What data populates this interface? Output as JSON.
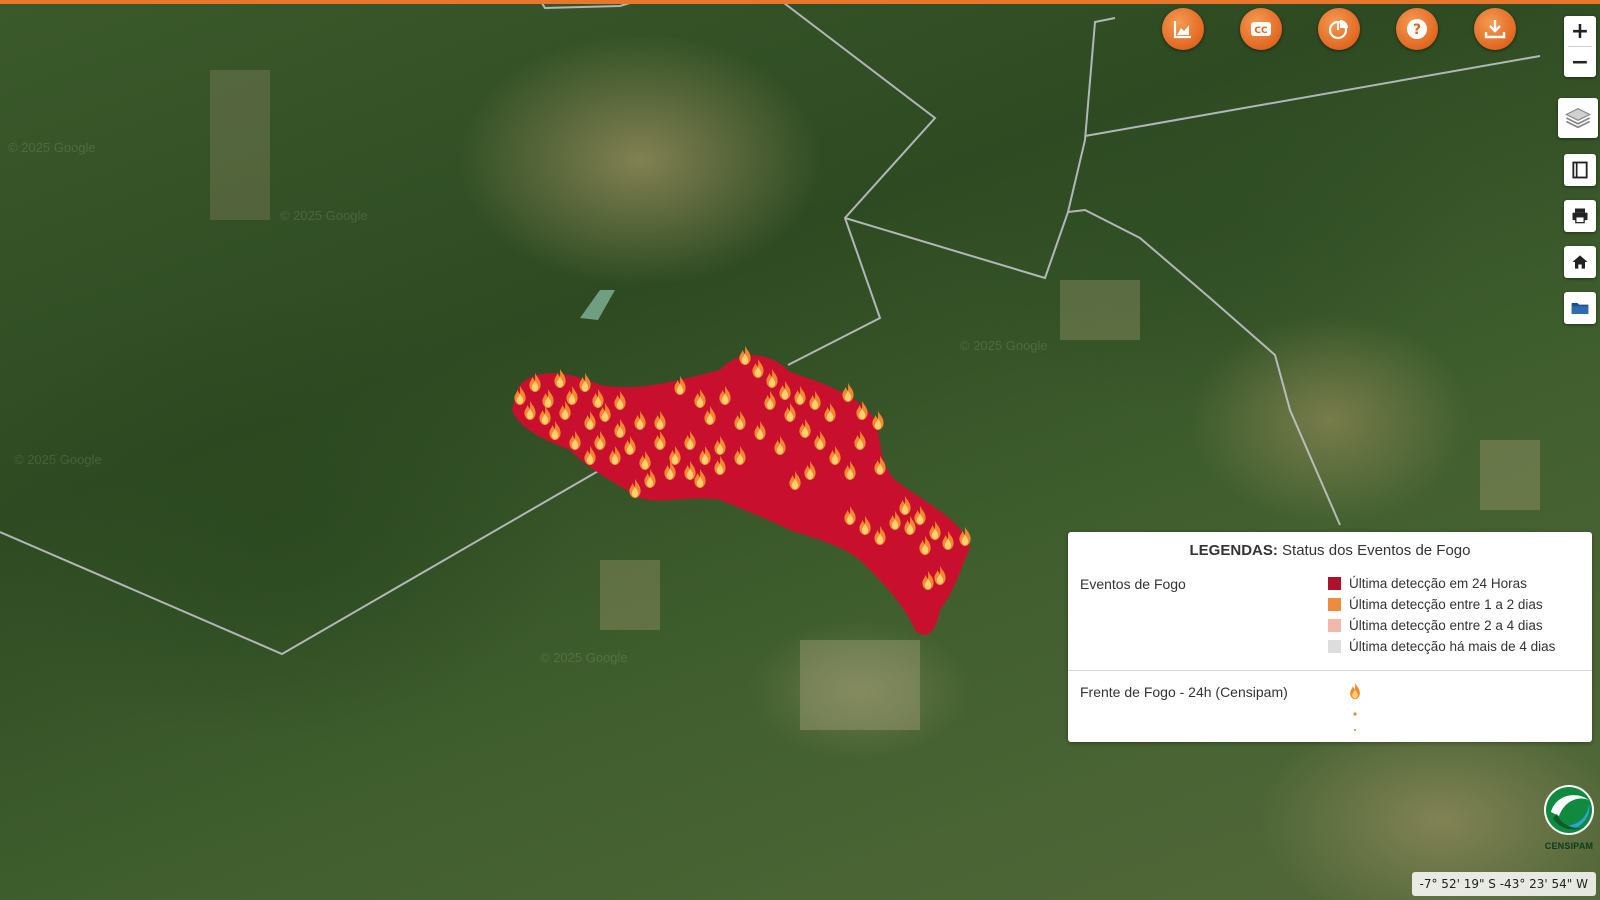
{
  "toolbar": {
    "buttons": [
      {
        "name": "chart-button",
        "icon": "area-chart-icon"
      },
      {
        "name": "cc-button",
        "icon": "cc-icon",
        "label": "CC"
      },
      {
        "name": "pie-chart-button",
        "icon": "pie-chart-icon"
      },
      {
        "name": "help-button",
        "icon": "question-icon",
        "label": "?"
      },
      {
        "name": "download-button",
        "icon": "download-icon"
      }
    ],
    "accent_color": "#e8762b"
  },
  "zoom": {
    "in_label": "+",
    "out_label": "−"
  },
  "side_buttons": [
    {
      "name": "layers-button",
      "icon": "layers-icon"
    },
    {
      "name": "frame-button",
      "icon": "frame-icon"
    },
    {
      "name": "print-button",
      "icon": "print-icon"
    },
    {
      "name": "home-button",
      "icon": "home-icon"
    },
    {
      "name": "folder-button",
      "icon": "folder-icon"
    }
  ],
  "legend": {
    "title_bold": "LEGENDAS:",
    "title_rest": "Status dos Eventos de Fogo",
    "group1_label": "Eventos de Fogo",
    "items": [
      {
        "label": "Última detecção em 24 Horas",
        "color": "#b0112a"
      },
      {
        "label": "Última detecção entre 1 a 2 dias",
        "color": "#f08a3c"
      },
      {
        "label": "Última detecção entre 2 a 4 dias",
        "color": "#f2b8aa"
      },
      {
        "label": "Última detecção há mais de 4 dias",
        "color": "#dddddd"
      }
    ],
    "group2_label": "Frente de Fogo - 24h (Censipam)",
    "fire_front_icon": "flame-icon"
  },
  "logo": {
    "text": "CENSIPAM"
  },
  "coords": {
    "text": "-7° 52' 19\" S -43° 23' 54\" W"
  },
  "map": {
    "watermark": "© 2025 Google",
    "fire_color": "#c8102e"
  }
}
